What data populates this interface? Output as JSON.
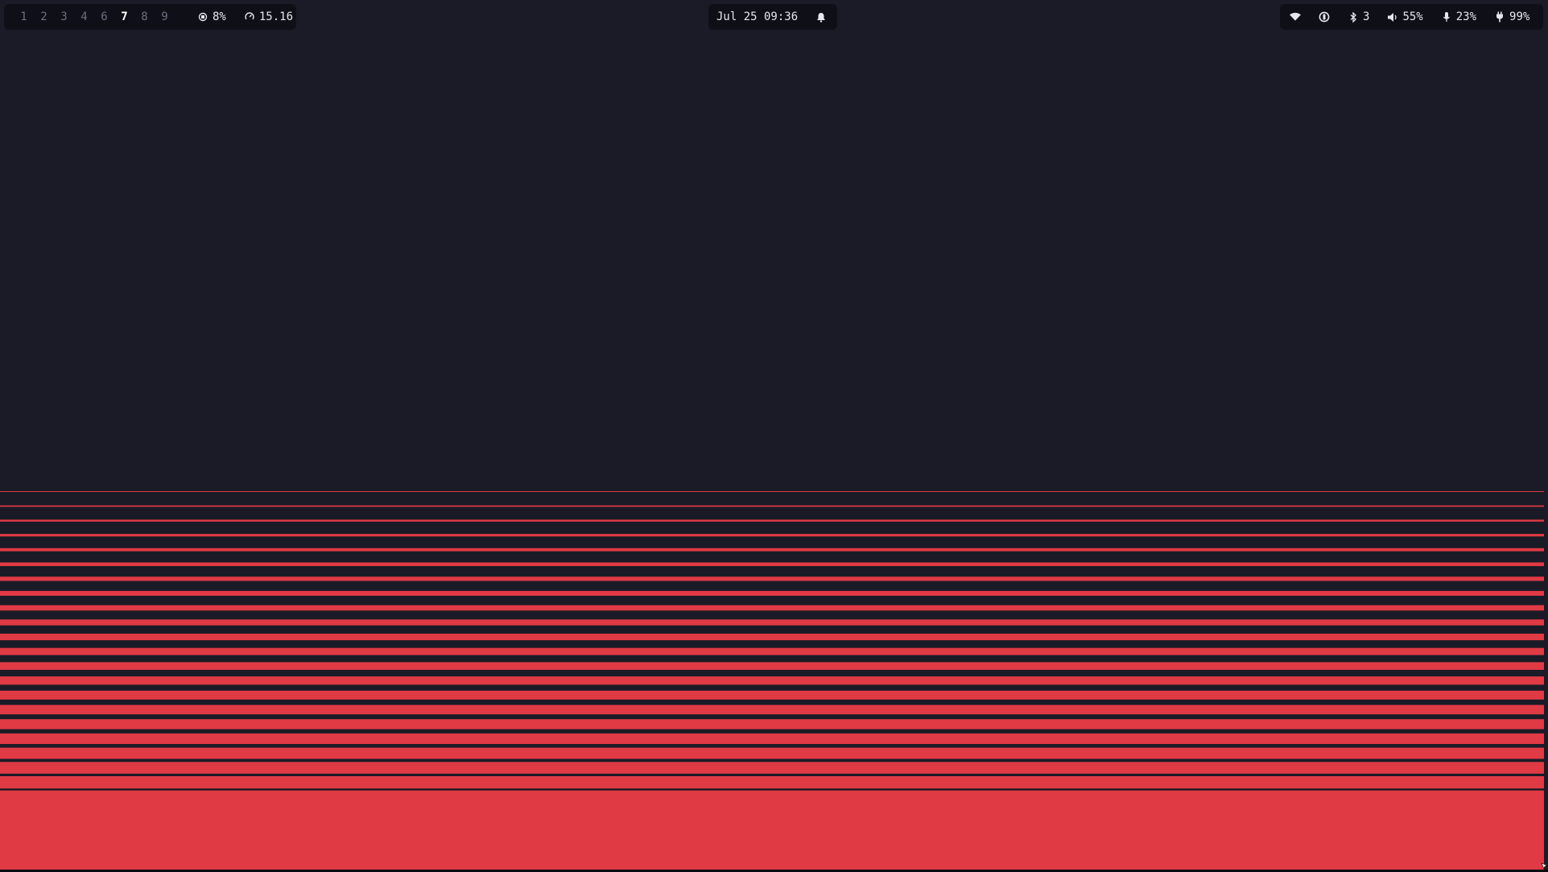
{
  "topbar": {
    "workspaces": [
      {
        "label": "1",
        "active": false
      },
      {
        "label": "2",
        "active": false
      },
      {
        "label": "3",
        "active": false
      },
      {
        "label": "4",
        "active": false
      },
      {
        "label": "6",
        "active": false
      },
      {
        "label": "7",
        "active": true
      },
      {
        "label": "8",
        "active": false
      },
      {
        "label": "9",
        "active": false
      }
    ],
    "cpu": {
      "icon": "cpu-icon",
      "value": "8%"
    },
    "load": {
      "icon": "gauge-icon",
      "value": "15.16"
    },
    "datetime": "Jul 25 09:36",
    "notification_icon": "bell-icon",
    "status": {
      "wifi_icon": "wifi-icon",
      "power_profile_icon": "power-profile-icon",
      "bluetooth": {
        "icon": "bluetooth-icon",
        "value": "3"
      },
      "volume": {
        "icon": "volume-icon",
        "value": "55%"
      },
      "microphone": {
        "icon": "microphone-icon",
        "value": "23%"
      },
      "battery": {
        "icon": "plug-icon",
        "value": "99%"
      }
    }
  },
  "colors": {
    "background": "#1a1b26",
    "bar_module": "#0f1017",
    "accent_red": "#e03a45",
    "text": "#e6e7ec",
    "inactive_workspace": "#6b6f80"
  }
}
